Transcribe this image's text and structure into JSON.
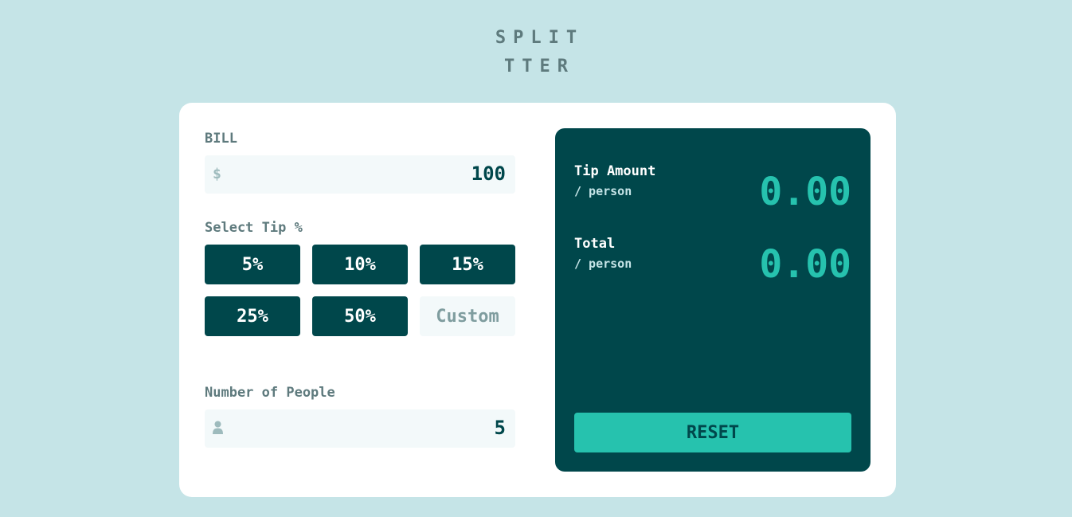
{
  "header": {
    "logo_line1": "SPLIT",
    "logo_line2": "TTER"
  },
  "bill": {
    "label": "BILL",
    "currency_symbol": "$",
    "value": "100"
  },
  "tip": {
    "label": "Select Tip %",
    "options": [
      "5%",
      "10%",
      "15%",
      "25%",
      "50%"
    ],
    "custom_placeholder": "Custom"
  },
  "people": {
    "label": "Number of People",
    "value": "5",
    "icon": "person-icon"
  },
  "results": {
    "tip_label": "Tip Amount",
    "tip_sub": "/ person",
    "tip_value": "0.00",
    "total_label": "Total",
    "total_sub": "/ person",
    "total_value": "0.00",
    "reset_label": "RESET"
  },
  "colors": {
    "background": "#c5e4e7",
    "card": "#ffffff",
    "dark_cyan": "#00474b",
    "strong_cyan": "#26c2ae",
    "input_bg": "#f3f9fa",
    "label_gray": "#5e7a7d"
  }
}
